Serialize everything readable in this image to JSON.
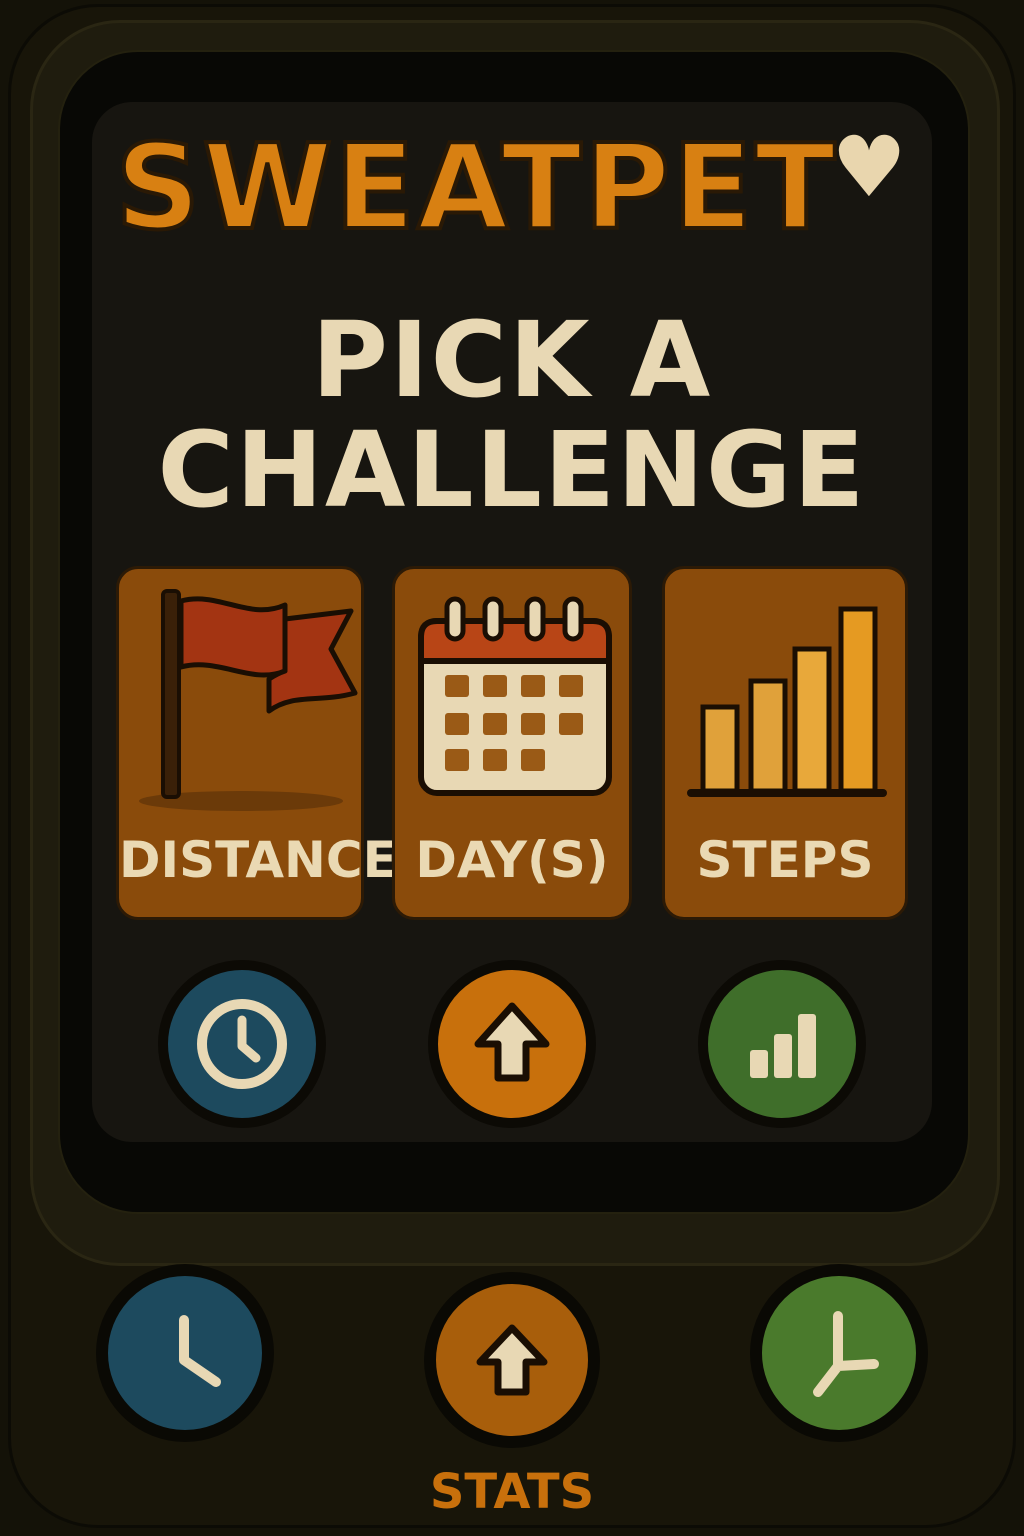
{
  "app": {
    "name": "SWEATPET",
    "heart_icon": "heart-icon"
  },
  "main": {
    "headline_line1": "PICK A",
    "headline_line2": "CHALLENGE",
    "challenges": [
      {
        "label": "DISTANCE",
        "icon": "flag-icon"
      },
      {
        "label": "DAY(S)",
        "icon": "calendar-icon"
      },
      {
        "label": "STEPS",
        "icon": "bar-chart-icon"
      }
    ],
    "action_buttons": [
      {
        "icon": "clock-icon",
        "color": "#1d4a5e"
      },
      {
        "icon": "up-arrow-icon",
        "color": "#c8700c"
      },
      {
        "icon": "signal-bars-icon",
        "color": "#3f6e2a"
      }
    ]
  },
  "bottom_nav": {
    "buttons": [
      {
        "icon": "clock-icon",
        "color": "#1d4a5e"
      },
      {
        "icon": "up-arrow-icon",
        "color": "#a85e0b"
      },
      {
        "icon": "clock-icon",
        "color": "#4a7a2c"
      }
    ],
    "label": "STATS"
  },
  "colors": {
    "accent": "#d88012",
    "card": "#8a4b0b",
    "text": "#e8d8b4",
    "background": "#141208"
  }
}
